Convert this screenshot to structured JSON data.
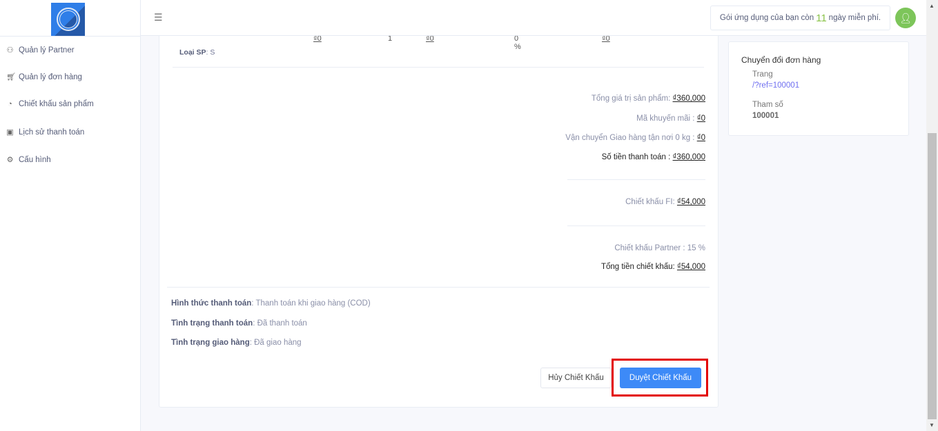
{
  "logo": {
    "alt": "app logo"
  },
  "sidebar": {
    "items": [
      {
        "label": "Quản lý Partner",
        "icon": "sitemap-icon"
      },
      {
        "label": "Quản lý đơn hàng",
        "icon": "cart-icon"
      },
      {
        "label": "Chiết khấu sản phẩm",
        "icon": "pie-chart-icon"
      },
      {
        "label": "Lịch sử thanh toán",
        "icon": "wallet-icon"
      },
      {
        "label": "Cấu hình",
        "icon": "gear-icon"
      }
    ]
  },
  "header": {
    "trial_prefix": "Gói ứng dụng của bạn còn",
    "trial_days": "11",
    "trial_suffix": "ngày miễn phí."
  },
  "product": {
    "price": "₫0",
    "quantity": "1",
    "discount_amount": "₫0",
    "discount_percent": "0 %",
    "total": "₫0",
    "type_label": "Loại SP",
    "type_value": ": S"
  },
  "summary": {
    "subtotal_label": "Tổng giá trị sản phẩm: ",
    "subtotal": "₫360,000",
    "promo_label": "Mã khuyến mãi : ",
    "promo": "₫0",
    "shipping_label": "Vận chuyển Giao hàng tận nơi 0 kg : ",
    "shipping": "₫0",
    "payment_label": "Số tiền thanh toán : ",
    "payment": "₫360,000",
    "fi_label": "Chiết khấu FI: ",
    "fi": "₫54,000",
    "partner_label": "Chiết khấu Partner : 15 %",
    "total_discount_label": "Tổng tiền chiết khấu: ",
    "total_discount": "₫54,000"
  },
  "order_info": [
    {
      "label": "Hình thức thanh toán",
      "value": ": Thanh toán khi giao hàng (COD)"
    },
    {
      "label": "Tình trạng thanh toán",
      "value": ": Đã thanh toán"
    },
    {
      "label": "Tình trạng giao hàng",
      "value": ": Đã giao hàng"
    }
  ],
  "actions": {
    "cancel": "Hủy Chiết Khấu",
    "approve": "Duyệt Chiết Khấu"
  },
  "conversion": {
    "title": "Chuyển đổi đơn hàng",
    "page_label": "Trang",
    "page_value": "/?ref=100001",
    "param_label": "Tham số",
    "param_value": "100001"
  },
  "colors": {
    "accent": "#3d8af7",
    "highlight": "#e30000",
    "trial_days": "#8ac34a",
    "avatar": "#7dc55a"
  }
}
